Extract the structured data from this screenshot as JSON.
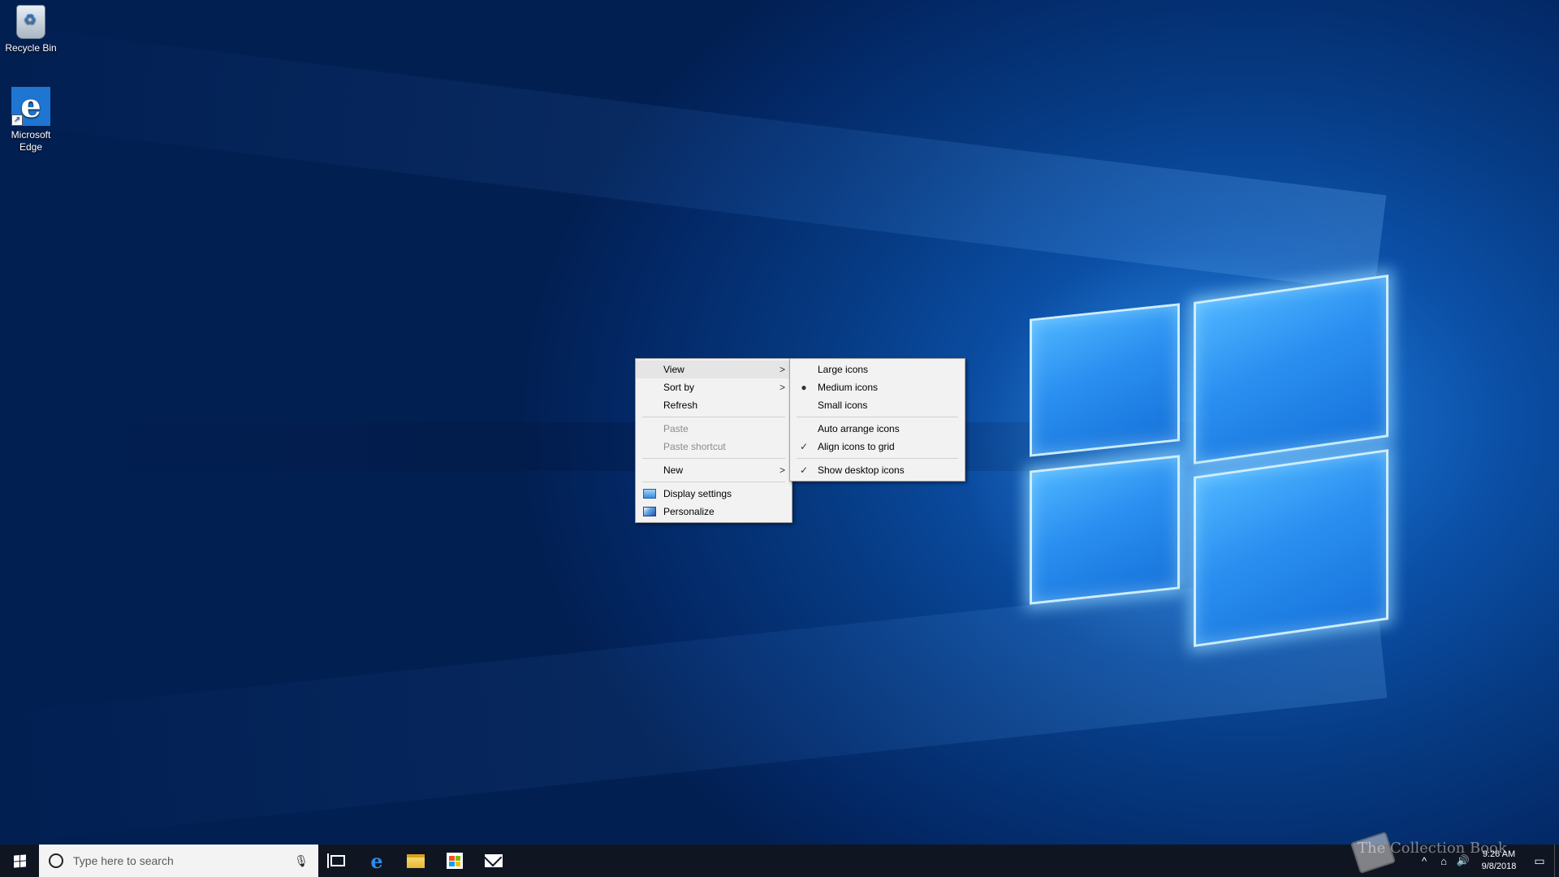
{
  "desktop": {
    "icons": [
      {
        "label": "Recycle Bin",
        "icon": "recycle-bin-icon"
      },
      {
        "label": "Microsoft\nEdge",
        "icon": "edge-icon"
      }
    ]
  },
  "context_menu": {
    "items": [
      {
        "label": "View",
        "has_submenu": true,
        "highlighted": true
      },
      {
        "label": "Sort by",
        "has_submenu": true
      },
      {
        "label": "Refresh"
      },
      {
        "label": "Paste",
        "disabled": true
      },
      {
        "label": "Paste shortcut",
        "disabled": true
      },
      {
        "label": "New",
        "has_submenu": true
      },
      {
        "label": "Display settings",
        "icon": "display-settings-icon"
      },
      {
        "label": "Personalize",
        "icon": "personalize-icon"
      }
    ]
  },
  "view_submenu": {
    "items": [
      {
        "label": "Large icons"
      },
      {
        "label": "Medium icons",
        "mark": "bullet"
      },
      {
        "label": "Small icons"
      },
      {
        "label": "Auto arrange icons"
      },
      {
        "label": "Align icons to grid",
        "mark": "check"
      },
      {
        "label": "Show desktop icons",
        "mark": "check"
      }
    ]
  },
  "taskbar": {
    "search_placeholder": "Type here to search",
    "pinned": [
      "task-view-icon",
      "edge-icon",
      "file-explorer-icon",
      "store-icon",
      "mail-icon"
    ],
    "clock_time": "9:26 AM",
    "clock_date": "9/8/2018",
    "watermark": "The Collection Book"
  },
  "colors": {
    "taskbar": "#101522",
    "menu_bg": "#f2f2f2",
    "menu_highlight": "#e5e5e5",
    "disabled_text": "#8c8c8c",
    "accent": "#1e76d2"
  }
}
